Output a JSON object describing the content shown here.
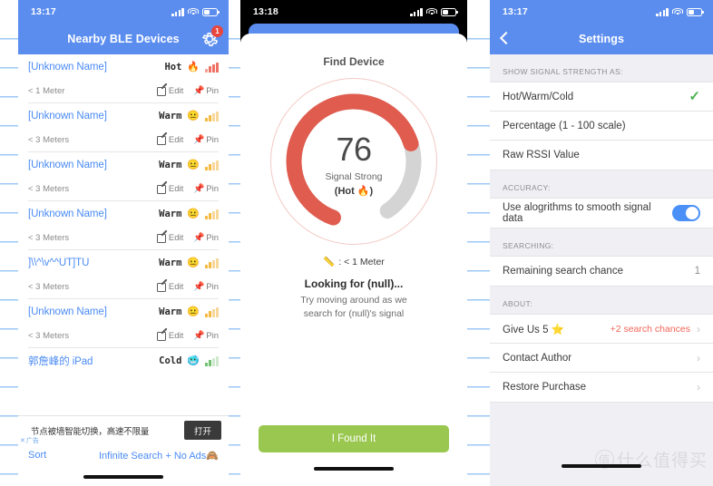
{
  "background": {
    "rule_color": "#9ec8f5",
    "paper_color": "#ffffff"
  },
  "colors": {
    "brand_blue": "#5b8def",
    "link_blue": "#4b8bf4",
    "hot_red": "#e05c4f",
    "warm_orange": "#f4b93f",
    "cold_green": "#6fc06f",
    "found_green": "#9ac750",
    "accent_red": "#f2655a",
    "check_green": "#4cb050"
  },
  "phone1": {
    "status": {
      "time": "13:17",
      "icons": [
        "cellular-icon",
        "wifi-icon",
        "battery-icon"
      ]
    },
    "nav": {
      "title": "Nearby BLE Devices",
      "gear_icon": "gear-icon",
      "badge": "1"
    },
    "devices": [
      {
        "name": "[Unknown Name]",
        "temp": "Hot",
        "emoji": "🔥",
        "level": "hot",
        "distance": "< 1 Meter",
        "edit": "Edit",
        "pin": "Pin"
      },
      {
        "name": "[Unknown Name]",
        "temp": "Warm",
        "emoji": "😐",
        "level": "warm",
        "distance": "< 3 Meters",
        "edit": "Edit",
        "pin": "Pin"
      },
      {
        "name": "[Unknown Name]",
        "temp": "Warm",
        "emoji": "😐",
        "level": "warm",
        "distance": "< 3 Meters",
        "edit": "Edit",
        "pin": "Pin"
      },
      {
        "name": "[Unknown Name]",
        "temp": "Warm",
        "emoji": "😐",
        "level": "warm",
        "distance": "< 3 Meters",
        "edit": "Edit",
        "pin": "Pin"
      },
      {
        "name": "]\\\\^\\v^^UT]TU",
        "temp": "Warm",
        "emoji": "😐",
        "level": "warm",
        "distance": "< 3 Meters",
        "edit": "Edit",
        "pin": "Pin"
      },
      {
        "name": "[Unknown Name]",
        "temp": "Warm",
        "emoji": "😐",
        "level": "warm",
        "distance": "< 3 Meters",
        "edit": "Edit",
        "pin": "Pin"
      },
      {
        "name": "郭詹峰的 iPad",
        "temp": "Cold",
        "emoji": "🥶",
        "level": "cold",
        "distance": "",
        "edit": "",
        "pin": ""
      }
    ],
    "ad": {
      "text": "节点被墙智能切换，高速不限量",
      "button": "打开",
      "tag": "广告",
      "close_icon": "close-icon"
    },
    "bottom": {
      "sort": "Sort",
      "promo": "Infinite Search + No Ads",
      "promo_emoji": "🙈"
    }
  },
  "phone2": {
    "status": {
      "time": "13:18",
      "icons": [
        "cellular-icon",
        "wifi-icon",
        "battery-icon"
      ]
    },
    "sheet_title": "Find Device",
    "gauge": {
      "value": "76",
      "label": "Signal Strong",
      "sublabel": "(Hot 🔥)",
      "percent": 76,
      "track_color": "#d4d4d4",
      "fill_color": "#e05c4f"
    },
    "distance": {
      "icon": "ruler-icon",
      "text": ": < 1 Meter"
    },
    "looking": "Looking for (null)...",
    "hint": "Try moving around as we search for (null)'s signal",
    "found_button": "I Found It"
  },
  "phone3": {
    "status": {
      "time": "13:17",
      "icons": [
        "cellular-icon",
        "wifi-icon",
        "battery-icon"
      ]
    },
    "nav": {
      "title": "Settings",
      "back_icon": "chevron-left-icon"
    },
    "sections": [
      {
        "header": "SHOW SIGNAL STRENGTH AS:",
        "rows": [
          {
            "label": "Hot/Warm/Cold",
            "check": "✓"
          },
          {
            "label": "Percentage (1 - 100 scale)"
          },
          {
            "label": "Raw RSSI Value"
          }
        ]
      },
      {
        "header": "ACCURACY:",
        "rows": [
          {
            "label": "Use alogrithms to smooth signal data",
            "toggle": true
          }
        ]
      },
      {
        "header": "SEARCHING:",
        "rows": [
          {
            "label": "Remaining search chance",
            "value": "1"
          }
        ]
      },
      {
        "header": "ABOUT:",
        "rows": [
          {
            "label": "Give Us 5 ⭐",
            "accent": "+2 search chances",
            "chevron": "›"
          },
          {
            "label": "Contact Author",
            "chevron": "›"
          },
          {
            "label": "Restore Purchase",
            "chevron": "›"
          }
        ]
      }
    ],
    "watermark": {
      "mark": "值",
      "text": "什么值得买"
    }
  }
}
